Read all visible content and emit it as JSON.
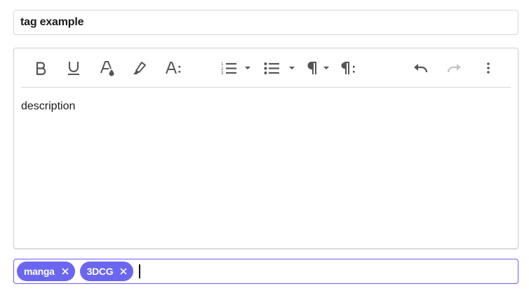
{
  "title_field": {
    "value": "tag example"
  },
  "editor": {
    "toolbar": {
      "icons": [
        "bold-icon",
        "underline-icon",
        "font-color-icon",
        "highlighter-icon",
        "font-size-icon",
        "ordered-list-icon",
        "chevron-down-icon",
        "bullet-list-icon",
        "chevron-down-icon",
        "paragraph-icon",
        "chevron-down-icon",
        "paragraph-settings-icon",
        "undo-icon",
        "redo-icon",
        "more-vertical-icon"
      ]
    },
    "body_text": "description"
  },
  "tags": {
    "items": [
      {
        "label": "manga"
      },
      {
        "label": "3DCG"
      }
    ],
    "input_value": ""
  },
  "colors": {
    "accent": "#6b66f0",
    "focus_border": "#6b5cf5",
    "icon": "#555555",
    "icon_disabled": "#c4c4c4"
  }
}
